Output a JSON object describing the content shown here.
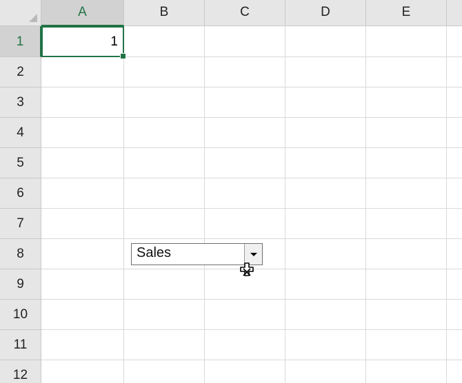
{
  "sheet": {
    "columns": [
      "A",
      "B",
      "C",
      "D",
      "E"
    ],
    "rows": [
      "1",
      "2",
      "3",
      "4",
      "5",
      "6",
      "7",
      "8",
      "9",
      "10",
      "11",
      "12"
    ],
    "active_cell": {
      "column": "A",
      "row": "1"
    },
    "cells": {
      "A1": "1"
    }
  },
  "combo_box": {
    "value": "Sales",
    "cell": "B8"
  },
  "cursor": "move-cursor-icon"
}
